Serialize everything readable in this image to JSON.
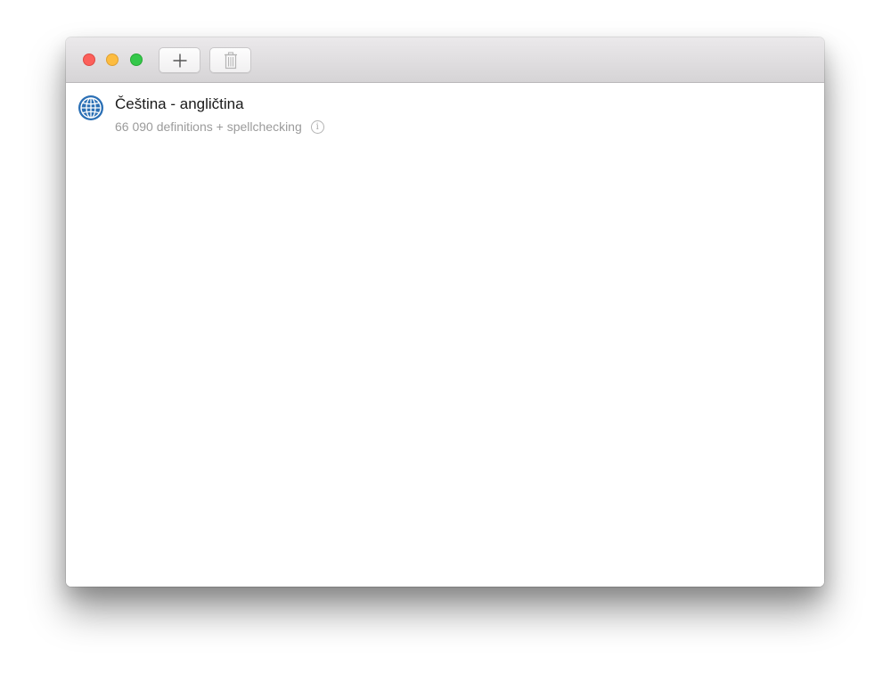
{
  "window": {
    "toolbar": {
      "add_icon": "plus-icon",
      "delete_icon": "trash-icon"
    },
    "dictionaries": [
      {
        "icon": "globe-icon",
        "title": "Čeština - angličtina",
        "subtitle": "66 090 definitions + spellchecking",
        "info_icon": "info-icon",
        "info_glyph": "i"
      }
    ]
  },
  "colors": {
    "close": "#fc605b",
    "minimize": "#fdbc40",
    "zoom": "#34c84a",
    "globe_blue": "#2a6fb5",
    "subtitle_gray": "#9b9b9b"
  }
}
